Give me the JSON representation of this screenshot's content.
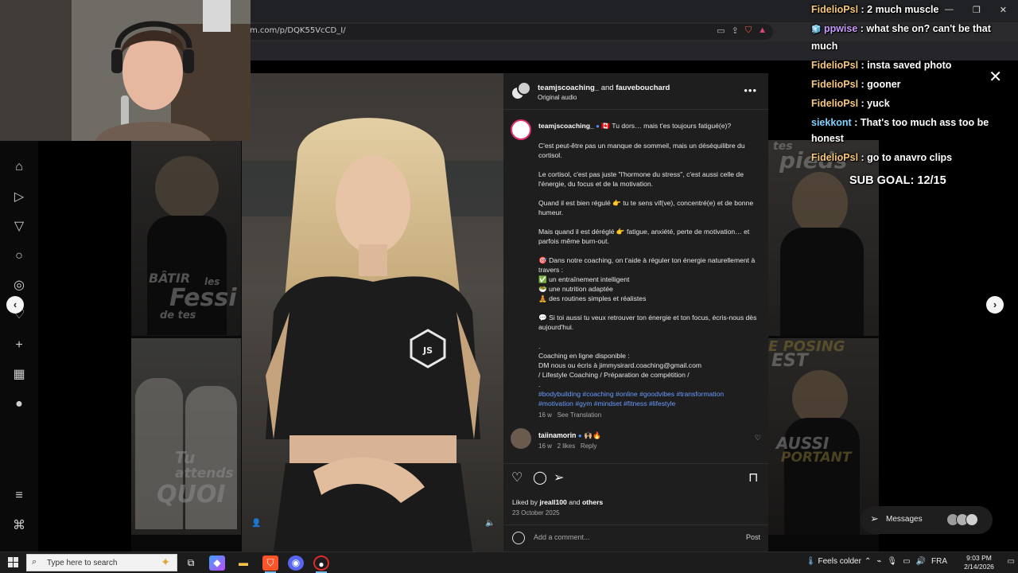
{
  "browser": {
    "url": "m.com/p/DQK55VcCD_I/"
  },
  "chat": {
    "messages": [
      {
        "user": "FidelioPsl",
        "text": ": 2 much muscle"
      },
      {
        "user": "ppwise",
        "text": ": what she on? can't be that much"
      },
      {
        "user": "FidelioPsl",
        "text": ": insta saved photo"
      },
      {
        "user": "FidelioPsl",
        "text": ": gooner"
      },
      {
        "user": "FidelioPsl",
        "text": ": yuck"
      },
      {
        "user": "siekkont",
        "text": ": That's too much ass too be honest"
      },
      {
        "user": "FidelioPsl",
        "text": ": go to anavro clips"
      }
    ],
    "sub_goal": "SUB GOAL: 12/15"
  },
  "post": {
    "header": {
      "user1": "teamjscoaching_",
      "and": "and",
      "user2": "fauvebouchard",
      "sub": "Original audio"
    },
    "caption": {
      "username": "teamjscoaching_",
      "first_line": "🇨🇦 Tu dors… mais t'es toujours fatigué(e)?",
      "p1": "C'est peut-être pas un manque de sommeil, mais un déséquilibre du cortisol.",
      "p2": "Le cortisol, c'est pas juste \"l'hormone du stress\", c'est aussi celle de l'énergie, du focus et de la motivation.",
      "p3": "Quand il est bien régulé 👉 tu te sens vif(ve), concentré(e) et de bonne humeur.",
      "p4": "Mais quand il est déréglé 👉 fatigue, anxiété, perte de motivation… et parfois même burn-out.",
      "p5_intro": "🎯 Dans notre coaching, on t'aide à réguler ton énergie naturellement à travers :",
      "p5_item1": "✅ un entraînement intelligent",
      "p5_item2": "🥗 une nutrition adaptée",
      "p5_item3": "🧘 des routines simples et réalistes",
      "p6": "💬 Si toi aussi tu veux retrouver ton énergie et ton focus, écris-nous dès aujourd'hui.",
      "dot": ".",
      "l1": "Coaching en ligne disponible :",
      "l2": "DM nous ou écris à jimmysirard.coaching@gmail.com",
      "l3": "/ Lifestyle Coaching / Préparation de compétition /",
      "dot2": ".",
      "hashtags": "#bodybuilding #coaching #online #goodvibes #transformation #motivation #gym #mindset #fitness #lifestyle",
      "age": "16 w",
      "translation": "See Translation"
    },
    "comment": {
      "username": "taiinamorin",
      "emoji": "🙌🏼🔥",
      "age": "16 w",
      "likes": "2 likes",
      "reply": "Reply"
    },
    "liked_by_prefix": "Liked by",
    "liked_by_user": "jreall100",
    "liked_by_and": "and",
    "liked_by_others": "others",
    "date": "23 October 2025",
    "add_comment_placeholder": "Add a comment...",
    "post_label": "Post"
  },
  "background_tiles": {
    "t1_line1": "BÂTIR",
    "t1_line2": "les",
    "t1_line3": "Fessi",
    "t1_line4": "de tes",
    "t2_line1": "Tu",
    "t2_line2": "attends",
    "t2_line3": "QUOI",
    "t3_line1": "tes",
    "t3_line2": "pieds",
    "t4_line1": "E POSING",
    "t4_line2": "EST",
    "t5_line1": "AUSSI",
    "t5_line2": "PORTANT"
  },
  "messages_pill": {
    "label": "Messages"
  },
  "taskbar": {
    "search_placeholder": "Type here to search",
    "weather": "Feels colder",
    "lang": "FRA",
    "time": "9:03 PM",
    "date": "2/14/2026"
  },
  "colors": {
    "accent_blue": "#6a9bff",
    "chat_user_gold": "#f7c77a",
    "insta_ring": "#e1306c"
  }
}
